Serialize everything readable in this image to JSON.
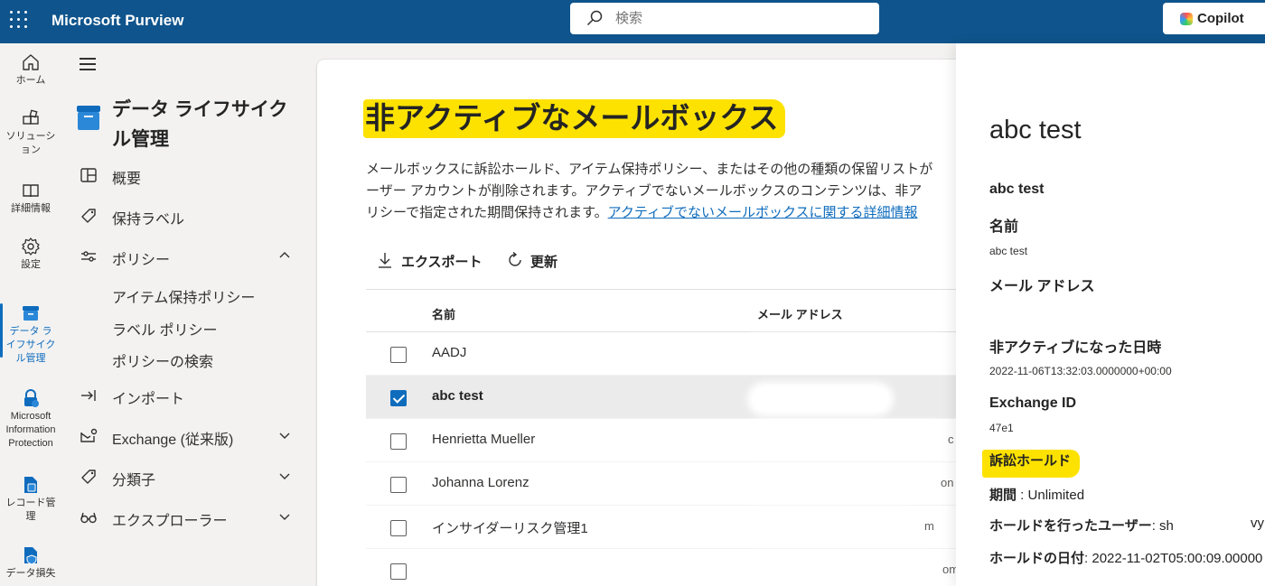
{
  "app": {
    "brand": "Microsoft Purview"
  },
  "search": {
    "placeholder": "検索"
  },
  "copilot": {
    "label": "Copilot"
  },
  "rail": {
    "items": [
      {
        "label": "ホーム",
        "icon": "home-icon"
      },
      {
        "label": "ソリューション",
        "icon": "solutions-icon"
      },
      {
        "label": "詳細情報",
        "icon": "book-icon"
      },
      {
        "label": "設定",
        "icon": "gear-icon"
      },
      {
        "label": "データライフサイクル管理",
        "icon": "archive-icon",
        "active": true
      },
      {
        "label": "Microsoft Information Protection",
        "icon": "lock-icon"
      },
      {
        "label": "レコード管理",
        "icon": "records-icon"
      },
      {
        "label": "データ損失",
        "icon": "dlp-icon"
      }
    ]
  },
  "nav": {
    "solution_title": "データ ライフサイクル管理",
    "items": {
      "overview": "概要",
      "retention_labels": "保持ラベル",
      "policies": "ポリシー",
      "item_retention_policy": "アイテム保持ポリシー",
      "label_policy": "ラベル ポリシー",
      "policy_search": "ポリシーの検索",
      "import": "インポート",
      "exchange": "Exchange (従来版)",
      "classifiers": "分類子",
      "explorer": "エクスプローラー"
    }
  },
  "main": {
    "title": "非アクティブなメールボックス",
    "desc_line1": "メールボックスに訴訟ホールド、アイテム保持ポリシー、またはその他の種類の保留リストが",
    "desc_line2": "ーザー アカウントが削除されます。アクティブでないメールボックスのコンテンツは、非ア",
    "desc_line3": "リシーで指定された期間保持されます。",
    "desc_link": "アクティブでないメールボックスに関する詳細情報",
    "toolbar": {
      "export": "エクスポート",
      "refresh": "更新"
    },
    "table": {
      "columns": {
        "name": "名前",
        "email": "メール アドレス"
      },
      "rows": [
        {
          "name": "AADJ",
          "email_fragment": "",
          "checked": false
        },
        {
          "name": "abc test",
          "email_fragment": "",
          "checked": true
        },
        {
          "name": "Henrietta Mueller",
          "email_fragment": "c",
          "checked": false
        },
        {
          "name": "Johanna Lorenz",
          "email_fragment": "on",
          "checked": false
        },
        {
          "name": "インサイダーリスク管理1",
          "email_fragment": "m",
          "checked": false
        },
        {
          "name": "",
          "email_fragment": "om",
          "checked": false
        }
      ]
    }
  },
  "panel": {
    "title": "abc test",
    "subtitle": "abc test",
    "name_label": "名前",
    "name_value": "abc test",
    "email_label": "メール アドレス",
    "inactive_label": "非アクティブになった日時",
    "inactive_value": "2022-11-06T13:32:03.0000000+00:00",
    "exchange_id_label": "Exchange ID",
    "exchange_id_value": "47e1",
    "litigation_hold_label": "訴訟ホールド",
    "duration_label": "期間",
    "duration_value": " : Unlimited",
    "held_by_label": "ホールドを行ったユーザー",
    "held_by_value": ": sh",
    "held_by_tail": "vy",
    "hold_date_label": "ホールドの日付",
    "hold_date_value": ": 2022-11-02T05:00:09.00000"
  }
}
